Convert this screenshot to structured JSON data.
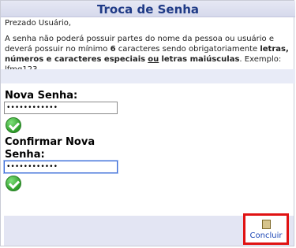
{
  "title": "Troca de Senha",
  "greeting": "Prezado Usuário,",
  "info": {
    "part1": "A senha não poderá possuir partes do nome da pessoa ou usuário e deverá possuir no mínimo ",
    "min_chars": "6",
    "part2": " caracteres sendo obrigatoriamente ",
    "required": "letras, números e caracteres especiais",
    "or_word": "ou",
    "upper": "letras maiúsculas",
    "example": ". Exemplo: lfmg123"
  },
  "new_password": {
    "label": "Nova Senha:",
    "value": "••••••••••••"
  },
  "confirm_password": {
    "label_line1": "Confirmar Nova",
    "label_line2": "Senha:",
    "value": "••••••••••••"
  },
  "button": {
    "label": "Concluir"
  },
  "colors": {
    "title": "#1f3a86",
    "accent_border": "#e01212",
    "link": "#1b46b5"
  },
  "icons": {
    "valid": "check-circle-icon",
    "concluir": "document-icon"
  }
}
